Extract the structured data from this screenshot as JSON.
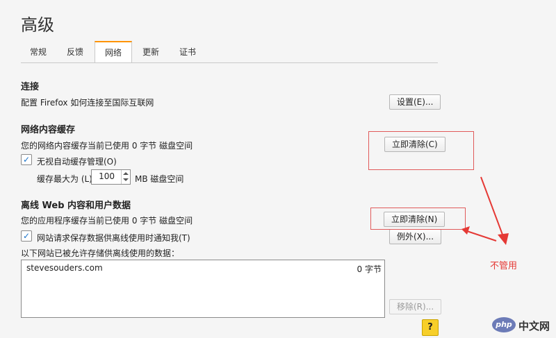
{
  "page_title": "高级",
  "tabs": [
    {
      "label": "常规",
      "active": false
    },
    {
      "label": "反馈",
      "active": false
    },
    {
      "label": "网络",
      "active": true
    },
    {
      "label": "更新",
      "active": false
    },
    {
      "label": "证书",
      "active": false
    }
  ],
  "connection": {
    "heading": "连接",
    "desc": "配置 Firefox 如何连接至国际互联网",
    "settings_button": "设置(E)..."
  },
  "cache": {
    "heading": "网络内容缓存",
    "usage": "您的网络内容缓存当前已使用 0 字节 磁盘空间",
    "clear_button": "立即清除(C)",
    "override_checkbox": {
      "label": "无视自动缓存管理(O)",
      "checked": true
    },
    "limit_label": "缓存最大为 (L)",
    "limit_value": "100",
    "limit_unit": "MB 磁盘空间"
  },
  "offline": {
    "heading": "离线 Web 内容和用户数据",
    "usage": "您的应用程序缓存当前已使用 0 字节 磁盘空间",
    "clear_button": "立即清除(N)",
    "notify_checkbox": {
      "label": "网站请求保存数据供离线使用时通知我(T)",
      "checked": true
    },
    "exceptions_button": "例外(X)...",
    "list_label": "以下网站已被允许存储供离线使用的数据：",
    "sites": [
      {
        "name": "stevesouders.com",
        "size": "0 字节"
      }
    ],
    "remove_button": "移除(R)..."
  },
  "annotation": {
    "text": "不管用",
    "color": "#e53935"
  },
  "help_button": "?",
  "watermark": {
    "logo": "php",
    "text": "中文网"
  },
  "colors": {
    "accent_tab": "#ff9400",
    "checkbox": "#1a73c9",
    "annotation": "#e53935"
  }
}
